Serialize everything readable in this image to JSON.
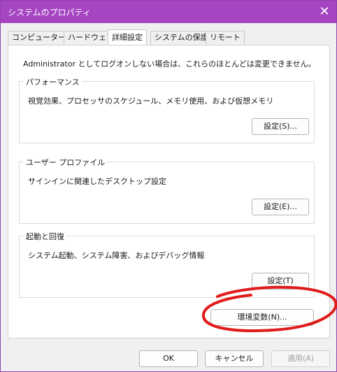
{
  "window": {
    "title": "システムのプロパティ"
  },
  "tabs": [
    {
      "label": "コンピューター名"
    },
    {
      "label": "ハードウェア"
    },
    {
      "label": "詳細設定"
    },
    {
      "label": "システムの保護"
    },
    {
      "label": "リモート"
    }
  ],
  "intro": "Administrator としてログオンしない場合は、これらのほとんどは変更できません。",
  "groups": {
    "performance": {
      "title": "パフォーマンス",
      "desc": "視覚効果、プロセッサのスケジュール、メモリ使用、および仮想メモリ",
      "button": "設定(S)..."
    },
    "profile": {
      "title": "ユーザー プロファイル",
      "desc": "サインインに関連したデスクトップ設定",
      "button": "設定(E)..."
    },
    "startup": {
      "title": "起動と回復",
      "desc": "システム起動、システム障害、およびデバッグ情報",
      "button": "設定(T)"
    }
  },
  "env_button": "環境変数(N)...",
  "footer": {
    "ok": "OK",
    "cancel": "キャンセル",
    "apply": "適用(A)"
  },
  "colors": {
    "titlebar": "#a545c2",
    "annotation": "#e01b1b"
  }
}
